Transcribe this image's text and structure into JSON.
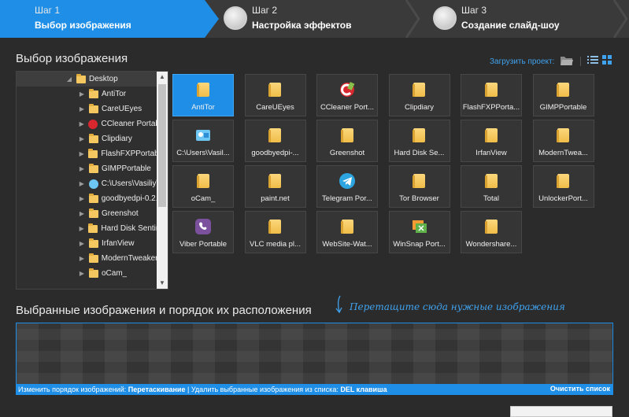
{
  "steps": [
    {
      "num": "Шаг 1",
      "title": "Выбор изображения",
      "active": true
    },
    {
      "num": "Шаг 2",
      "title": "Настройка эффектов",
      "active": false
    },
    {
      "num": "Шаг 3",
      "title": "Создание слайд-шоу",
      "active": false
    }
  ],
  "section": {
    "title": "Выбор изображения",
    "load_project": "Загрузить проект:"
  },
  "tree": {
    "root": "Desktop",
    "items": [
      {
        "label": "AntiTor",
        "icon": "folder"
      },
      {
        "label": "CareUEyes",
        "icon": "folder"
      },
      {
        "label": "CCleaner Portab",
        "icon": "ccleaner"
      },
      {
        "label": "Clipdiary",
        "icon": "folder"
      },
      {
        "label": "FlashFXPPortabl",
        "icon": "folder"
      },
      {
        "label": "GIMPPortable",
        "icon": "folder"
      },
      {
        "label": "C:\\Users\\Vasiliy\\",
        "icon": "image"
      },
      {
        "label": "goodbyedpi-0.2.",
        "icon": "folder"
      },
      {
        "label": "Greenshot",
        "icon": "folder"
      },
      {
        "label": "Hard Disk Sentin",
        "icon": "folder"
      },
      {
        "label": "IrfanView",
        "icon": "folder"
      },
      {
        "label": "ModernTweaker",
        "icon": "folder"
      },
      {
        "label": "oCam_",
        "icon": "folder"
      }
    ]
  },
  "grid": {
    "items": [
      {
        "label": "AntiTor",
        "icon": "folder",
        "selected": true
      },
      {
        "label": "CareUEyes",
        "icon": "folder"
      },
      {
        "label": "CCleaner Port...",
        "icon": "ccleaner"
      },
      {
        "label": "Clipdiary",
        "icon": "folder"
      },
      {
        "label": "FlashFXPPorta...",
        "icon": "folder"
      },
      {
        "label": "GIMPPortable",
        "icon": "folder"
      },
      {
        "label": "C:\\Users\\Vasil...",
        "icon": "image"
      },
      {
        "label": "goodbyedpi-...",
        "icon": "folder"
      },
      {
        "label": "Greenshot",
        "icon": "folder"
      },
      {
        "label": "Hard Disk Se...",
        "icon": "folder"
      },
      {
        "label": "IrfanView",
        "icon": "folder"
      },
      {
        "label": "ModernTwea...",
        "icon": "folder"
      },
      {
        "label": "oCam_",
        "icon": "folder"
      },
      {
        "label": "paint.net",
        "icon": "folder"
      },
      {
        "label": "Telegram Por...",
        "icon": "telegram"
      },
      {
        "label": "Tor Browser",
        "icon": "folder"
      },
      {
        "label": "Total",
        "icon": "folder"
      },
      {
        "label": "UnlockerPort...",
        "icon": "folder"
      },
      {
        "label": "Viber Portable",
        "icon": "viber"
      },
      {
        "label": "VLC media pl...",
        "icon": "folder"
      },
      {
        "label": "WebSite-Wat...",
        "icon": "folder"
      },
      {
        "label": "WinSnap Port...",
        "icon": "winsnap"
      },
      {
        "label": "Wondershare...",
        "icon": "folder"
      }
    ]
  },
  "selected": {
    "title": "Выбранные изображения и порядок их расположения",
    "drag_hint": "Перетащите сюда нужные изображения"
  },
  "status": {
    "reorder_label": "Изменить порядок изображений:",
    "reorder_value": "Перетаскивание",
    "separator": " | ",
    "delete_label": "Удалить выбранные изображения из списка:",
    "delete_value": "DEL клавиша",
    "clear": "Очистить список"
  },
  "colors": {
    "accent": "#1e8ee6",
    "background": "#2b2b2b",
    "tile": "#353535",
    "folder": "#f4c760"
  }
}
